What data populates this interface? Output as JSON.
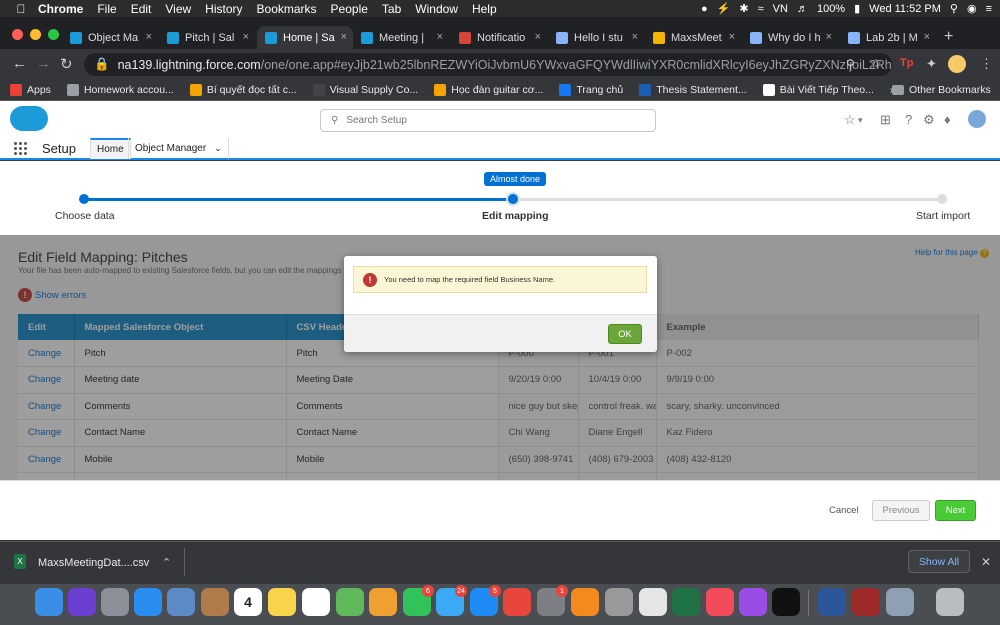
{
  "menubar": {
    "app": "Chrome",
    "items": [
      "File",
      "Edit",
      "View",
      "History",
      "Bookmarks",
      "People",
      "Tab",
      "Window",
      "Help"
    ],
    "battery": "100%",
    "datetime": "Wed 11:52 PM"
  },
  "tabs": [
    {
      "label": "Object Ma",
      "icon": "salesforce-icon",
      "color": "#1d9bd9"
    },
    {
      "label": "Pitch | Sal",
      "icon": "salesforce-icon",
      "color": "#1d9bd9"
    },
    {
      "label": "Home | Sa",
      "icon": "salesforce-icon",
      "color": "#1d9bd9",
      "active": true
    },
    {
      "label": "Meeting |",
      "icon": "salesforce-icon",
      "color": "#1d9bd9"
    },
    {
      "label": "Notificatio",
      "icon": "gmail-icon",
      "color": "#d44638"
    },
    {
      "label": "Hello I stu",
      "icon": "page-icon",
      "color": "#8ab4f8"
    },
    {
      "label": "MaxsMeet",
      "icon": "drive-icon",
      "color": "#f4b400"
    },
    {
      "label": "Why do I h",
      "icon": "page-icon",
      "color": "#8ab4f8"
    },
    {
      "label": "Lab 2b | M",
      "icon": "page-icon",
      "color": "#8ab4f8"
    }
  ],
  "url": {
    "host": "na139.lightning.force.com",
    "path": "/one/one.app#eyJjb21wb25lbnREZWYiOiJvbmU6YWxvaGFQYWdlIiwiYXR0cmlidXRlcyI6eyJhZGRyZXNzIjoiL2Rhd..."
  },
  "bookmarks": [
    {
      "label": "Apps",
      "color": "#ea4335"
    },
    {
      "label": "Homework accou...",
      "color": "#9aa0a6"
    },
    {
      "label": "Bí quyết đọc tất c...",
      "color": "#f4a300"
    },
    {
      "label": "Visual Supply Co...",
      "color": "#444"
    },
    {
      "label": "Học đàn guitar cơ...",
      "color": "#f4a300"
    },
    {
      "label": "Trang chủ",
      "color": "#1877f2"
    },
    {
      "label": "Thesis Statement...",
      "color": "#1a5fb4"
    },
    {
      "label": "Bài Viết Tiếp Theo...",
      "color": "#fff"
    }
  ],
  "other_bookmarks": "Other Bookmarks",
  "sf": {
    "search_placeholder": "Search Setup",
    "app_name": "Setup",
    "nav_home": "Home",
    "nav_object_manager": "Object Manager"
  },
  "progress": {
    "step1": "Choose data",
    "step2": "Edit mapping",
    "step3": "Start import",
    "tooltip": "Almost done"
  },
  "page": {
    "title": "Edit Field Mapping: Pitches",
    "subtitle": "Your file has been auto-mapped to existing Salesforce fields, but you can edit the mappings if yo",
    "help": "Help for this page",
    "show_errors": "Show errors"
  },
  "table": {
    "headers": [
      "Edit",
      "Mapped Salesforce Object",
      "CSV Header",
      "",
      "",
      "Example"
    ],
    "rows": [
      {
        "edit": "Change",
        "field": "Pitch",
        "csv": "Pitch",
        "ex1": "P-000",
        "ex2": "P-001",
        "ex3": "P-002"
      },
      {
        "edit": "Change",
        "field": "Meeting date",
        "csv": "Meeting Date",
        "ex1": "9/20/19 0:00",
        "ex2": "10/4/19 0:00",
        "ex3": "9/9/19 0:00"
      },
      {
        "edit": "Change",
        "field": "Comments",
        "csv": "Comments",
        "ex1": "nice guy but skepti",
        "ex2": "control freak. watc",
        "ex3": "scary, sharky. unconvinced"
      },
      {
        "edit": "Change",
        "field": "Contact Name",
        "csv": "Contact Name",
        "ex1": "Chi Wang",
        "ex2": "Diane Engell",
        "ex3": "Kaz Fidero"
      },
      {
        "edit": "Change",
        "field": "Mobile",
        "csv": "Mobile",
        "ex1": "(650) 398-9741",
        "ex2": "(408) 679-2003",
        "ex3": "(408) 432-8120"
      }
    ]
  },
  "footer": {
    "cancel": "Cancel",
    "previous": "Previous",
    "next": "Next"
  },
  "modal": {
    "message": "You need to map the required field Business Name.",
    "ok": "OK"
  },
  "download": {
    "filename": "MaxsMeetingDat....csv",
    "show_all": "Show All"
  },
  "dock": [
    {
      "name": "finder-icon",
      "color": "#3b8ee8"
    },
    {
      "name": "siri-icon",
      "color": "#6b3fd1"
    },
    {
      "name": "launchpad-icon",
      "color": "#8a8f98"
    },
    {
      "name": "safari-icon",
      "color": "#2a8ef0"
    },
    {
      "name": "preview-icon",
      "color": "#5c8ac7"
    },
    {
      "name": "contacts-icon",
      "color": "#b07b4a"
    },
    {
      "name": "calendar-icon",
      "color": "#ffffff",
      "label": "4"
    },
    {
      "name": "notes-icon",
      "color": "#f7d44a"
    },
    {
      "name": "reminders-icon",
      "color": "#ffffff"
    },
    {
      "name": "maps-icon",
      "color": "#5fb85a"
    },
    {
      "name": "photos-icon",
      "color": "#f0a030"
    },
    {
      "name": "facetime-icon",
      "color": "#32c25a",
      "badge": "6"
    },
    {
      "name": "messages-icon",
      "color": "#3ba9f5",
      "badge": "24"
    },
    {
      "name": "appstore-icon",
      "color": "#1f8cf5",
      "badge": "5"
    },
    {
      "name": "chrome-icon",
      "color": "#e8453c"
    },
    {
      "name": "system-preferences-icon",
      "color": "#7d7f84",
      "badge": "1"
    },
    {
      "name": "books-icon",
      "color": "#f28a1e"
    },
    {
      "name": "keynote-icon",
      "color": "#999999"
    },
    {
      "name": "textedit-icon",
      "color": "#e5e5e5"
    },
    {
      "name": "excel-icon",
      "color": "#1f7244"
    },
    {
      "name": "news-icon",
      "color": "#f24a5a"
    },
    {
      "name": "podcasts-icon",
      "color": "#9a4de6"
    },
    {
      "name": "appletv-icon",
      "color": "#111111"
    },
    {
      "name": "word-icon",
      "color": "#2b579a"
    },
    {
      "name": "dictionary-icon",
      "color": "#9e2a2a"
    },
    {
      "name": "image-capture-icon",
      "color": "#8fa0b5"
    },
    {
      "name": "trash-icon",
      "color": "#b9bcc1"
    }
  ]
}
